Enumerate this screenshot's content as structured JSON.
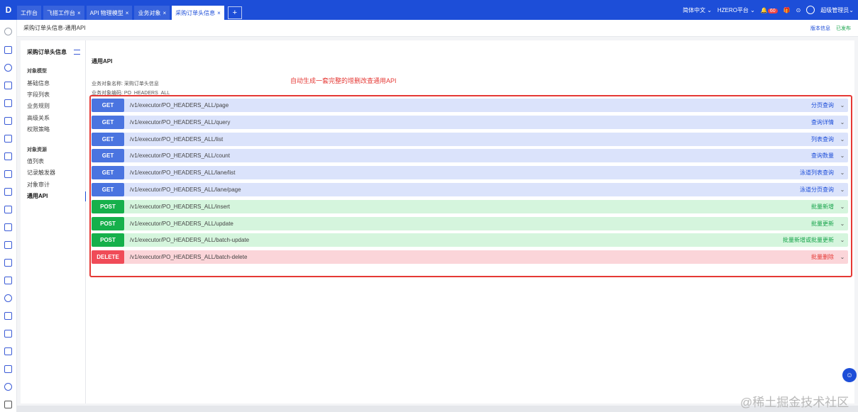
{
  "topbar": {
    "logo": "D",
    "tabs": [
      {
        "label": "工作台",
        "closable": false,
        "active": false
      },
      {
        "label": "飞搭工作台",
        "closable": true,
        "active": false
      },
      {
        "label": "API 物理模型",
        "closable": true,
        "active": false
      },
      {
        "label": "业务对象",
        "closable": true,
        "active": false
      },
      {
        "label": "采购订单头信息",
        "closable": true,
        "active": true
      }
    ],
    "add_tab": "+",
    "language": "简体中文",
    "platform": "HZERO平台",
    "notification_count": "60",
    "user": "超级管理员"
  },
  "subheader": {
    "breadcrumb": "采购订单头信息-通用API",
    "version_link": "版本信息",
    "status": "已发布"
  },
  "nav": {
    "title": "采购订单头信息",
    "groups": [
      {
        "label": "对象模型",
        "items": [
          "基础信息",
          "字段列表",
          "业务规则",
          "高级关系",
          "权限策略"
        ]
      },
      {
        "label": "对象资源",
        "items": [
          "值列表",
          "记录触发器",
          "对象审计",
          "通用API"
        ]
      }
    ],
    "active_item": "通用API"
  },
  "content": {
    "title": "通用API",
    "annotation": "自动生成一套完整的增删改查通用API",
    "object_name_label": "业务对象名称: 采购订单头信息",
    "object_code_label": "业务对象编码: PO_HEADERS_ALL"
  },
  "apis": [
    {
      "method": "GET",
      "kind": "get",
      "path": "/v1/executor/PO_HEADERS_ALL/page",
      "desc": "分页查询"
    },
    {
      "method": "GET",
      "kind": "get",
      "path": "/v1/executor/PO_HEADERS_ALL/query",
      "desc": "查询详情"
    },
    {
      "method": "GET",
      "kind": "get",
      "path": "/v1/executor/PO_HEADERS_ALL/list",
      "desc": "列表查询"
    },
    {
      "method": "GET",
      "kind": "get",
      "path": "/v1/executor/PO_HEADERS_ALL/count",
      "desc": "查询数量"
    },
    {
      "method": "GET",
      "kind": "get",
      "path": "/v1/executor/PO_HEADERS_ALL/lane/list",
      "desc": "泳道列表查询"
    },
    {
      "method": "GET",
      "kind": "get",
      "path": "/v1/executor/PO_HEADERS_ALL/lane/page",
      "desc": "泳道分页查询"
    },
    {
      "method": "POST",
      "kind": "post",
      "path": "/v1/executor/PO_HEADERS_ALL/insert",
      "desc": "批量新增"
    },
    {
      "method": "POST",
      "kind": "post",
      "path": "/v1/executor/PO_HEADERS_ALL/update",
      "desc": "批量更新"
    },
    {
      "method": "POST",
      "kind": "post",
      "path": "/v1/executor/PO_HEADERS_ALL/batch-update",
      "desc": "批量新增或批量更新"
    },
    {
      "method": "DELETE",
      "kind": "delete",
      "path": "/v1/executor/PO_HEADERS_ALL/batch-delete",
      "desc": "批量删除"
    }
  ],
  "watermark": "@稀土掘金技术社区",
  "colors": {
    "brand": "#1d4ed8",
    "get": "#4a74e0",
    "post": "#16b04b",
    "delete": "#f04b58",
    "annotation": "#e53935"
  }
}
